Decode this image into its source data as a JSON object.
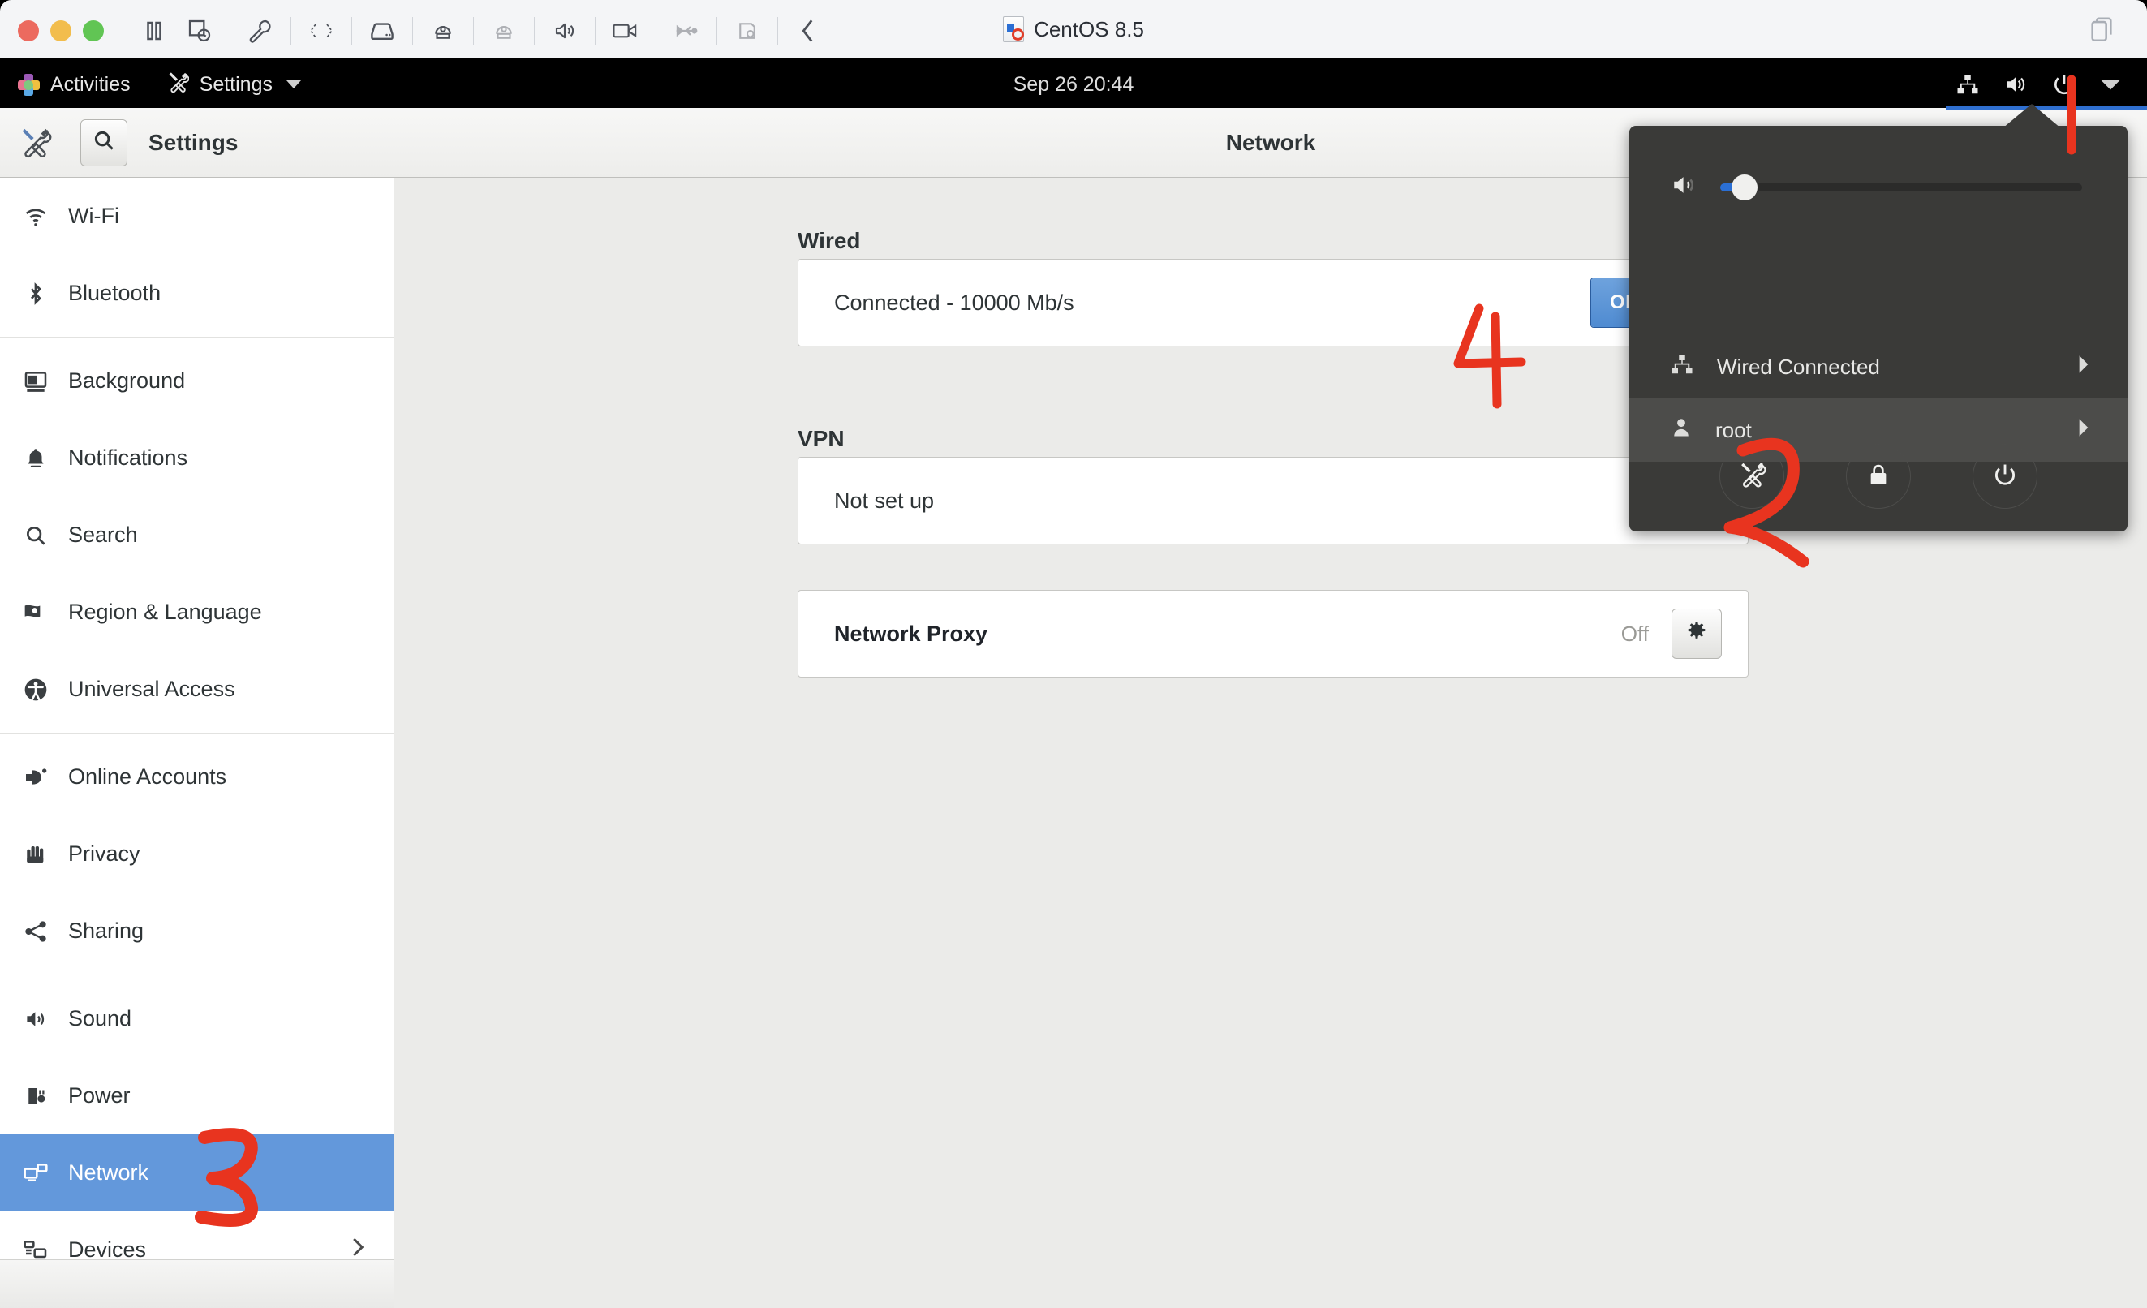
{
  "vm": {
    "title": "CentOS 8.5",
    "toolbar_icons": [
      {
        "name": "pause-icon",
        "dim": false
      },
      {
        "name": "snapshot-icon",
        "dim": false
      },
      {
        "name": "wrench-icon",
        "dim": false
      },
      {
        "name": "network-arrows-icon",
        "dim": false
      },
      {
        "name": "harddisk-icon",
        "dim": false
      },
      {
        "name": "cdrom-icon",
        "dim": false
      },
      {
        "name": "cdrom-secondary-icon",
        "dim": true
      },
      {
        "name": "speaker-icon",
        "dim": false
      },
      {
        "name": "camera-icon",
        "dim": false
      },
      {
        "name": "usb-icon",
        "dim": true
      },
      {
        "name": "printer-icon",
        "dim": true
      },
      {
        "name": "collapse-left-icon",
        "dim": false
      }
    ],
    "window_button": "restore-window-icon"
  },
  "topbar": {
    "activities": "Activities",
    "app_menu": "Settings",
    "clock": "Sep 26  20:44",
    "tray": [
      "network-wired-icon",
      "volume-icon",
      "power-icon",
      "chevron-down-icon"
    ]
  },
  "headerbar": {
    "app_icon": "settings-tools-icon",
    "search_icon": "search-icon",
    "sidebar_title": "Settings",
    "page_title": "Network"
  },
  "sidebar": {
    "groups": [
      {
        "items": [
          {
            "label": "Wi-Fi",
            "icon": "wifi-icon"
          },
          {
            "label": "Bluetooth",
            "icon": "bluetooth-icon"
          }
        ]
      },
      {
        "items": [
          {
            "label": "Background",
            "icon": "background-icon"
          },
          {
            "label": "Notifications",
            "icon": "bell-icon"
          },
          {
            "label": "Search",
            "icon": "search-icon"
          },
          {
            "label": "Region & Language",
            "icon": "flag-icon"
          },
          {
            "label": "Universal Access",
            "icon": "accessibility-icon"
          }
        ]
      },
      {
        "items": [
          {
            "label": "Online Accounts",
            "icon": "online-accounts-icon"
          },
          {
            "label": "Privacy",
            "icon": "hand-icon"
          },
          {
            "label": "Sharing",
            "icon": "share-icon"
          }
        ]
      },
      {
        "items": [
          {
            "label": "Sound",
            "icon": "speaker-icon"
          },
          {
            "label": "Power",
            "icon": "battery-plug-icon"
          },
          {
            "label": "Network",
            "icon": "network-icon",
            "selected": true
          },
          {
            "label": "Devices",
            "icon": "devices-icon",
            "chevron": "chevron-right-icon"
          }
        ]
      }
    ]
  },
  "network_page": {
    "wired": {
      "heading": "Wired",
      "status": "Connected - 10000 Mb/s",
      "toggle_label": "ON",
      "toggle_state": "on"
    },
    "vpn": {
      "heading": "VPN",
      "status": "Not set up"
    },
    "proxy": {
      "label": "Network Proxy",
      "value": "Off",
      "settings_icon": "gear-icon"
    }
  },
  "system_menu": {
    "volume": {
      "icon": "volume-low-icon",
      "percent": 2
    },
    "rows": [
      {
        "label": "Wired Connected",
        "icon": "network-wired-icon",
        "chevron": "chevron-right-icon",
        "highlight": false
      },
      {
        "label": "root",
        "icon": "user-icon",
        "chevron": "chevron-right-icon",
        "highlight": true
      }
    ],
    "actions": [
      {
        "name": "settings-button",
        "icon": "settings-tools-icon"
      },
      {
        "name": "lock-button",
        "icon": "lock-icon"
      },
      {
        "name": "power-button",
        "icon": "power-icon"
      }
    ]
  },
  "annotations": {
    "color": "#e8341f",
    "marks": [
      {
        "label": "1",
        "target": "topbar-power-icon"
      },
      {
        "label": "2",
        "target": "system-menu-settings-button"
      },
      {
        "label": "3",
        "target": "sidebar-item-network"
      },
      {
        "label": "4",
        "target": "wired-toggle"
      }
    ]
  }
}
